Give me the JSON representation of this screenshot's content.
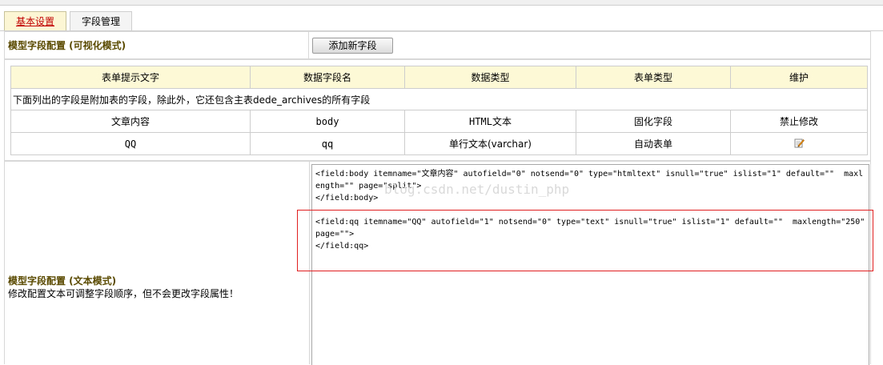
{
  "tabs": [
    {
      "label": "基本设置",
      "active": true
    },
    {
      "label": "字段管理",
      "active": false
    }
  ],
  "visual_mode": {
    "title": "模型字段配置 (可视化模式)",
    "add_button": "添加新字段"
  },
  "table": {
    "headers": [
      "表单提示文字",
      "数据字段名",
      "数据类型",
      "表单类型",
      "维护"
    ],
    "note": "下面列出的字段是附加表的字段，除此外，它还包含主表dede_archives的所有字段",
    "rows": [
      {
        "label": "文章内容",
        "field": "body",
        "data_type": "HTML文本",
        "form_type": "固化字段",
        "action": "禁止修改"
      },
      {
        "label": "QQ",
        "field": "qq",
        "data_type": "单行文本(varchar)",
        "form_type": "自动表单",
        "action_icon": "edit-icon"
      }
    ]
  },
  "text_mode": {
    "title": "模型字段配置 (文本模式)",
    "hint": "修改配置文本可调整字段顺序，但不会更改字段属性！",
    "code_lines": [
      "<field:body itemname=\"文章内容\" autofield=\"0\" notsend=\"0\" type=\"htmltext\" isnull=\"true\" islist=\"1\" default=\"\"  maxl",
      "ength=\"\" page=\"split\">",
      "</field:body>",
      "",
      "<field:qq itemname=\"QQ\" autofield=\"1\" notsend=\"0\" type=\"text\" isnull=\"true\" islist=\"1\" default=\"\"  maxlength=\"250\"",
      "page=\"\">",
      "</field:qq>"
    ]
  },
  "watermark": "blog.csdn.net/dustin_php",
  "colors": {
    "highlight_box": "#e02020",
    "active_tab_text": "#c00000",
    "header_bg": "#fdf8d6"
  }
}
